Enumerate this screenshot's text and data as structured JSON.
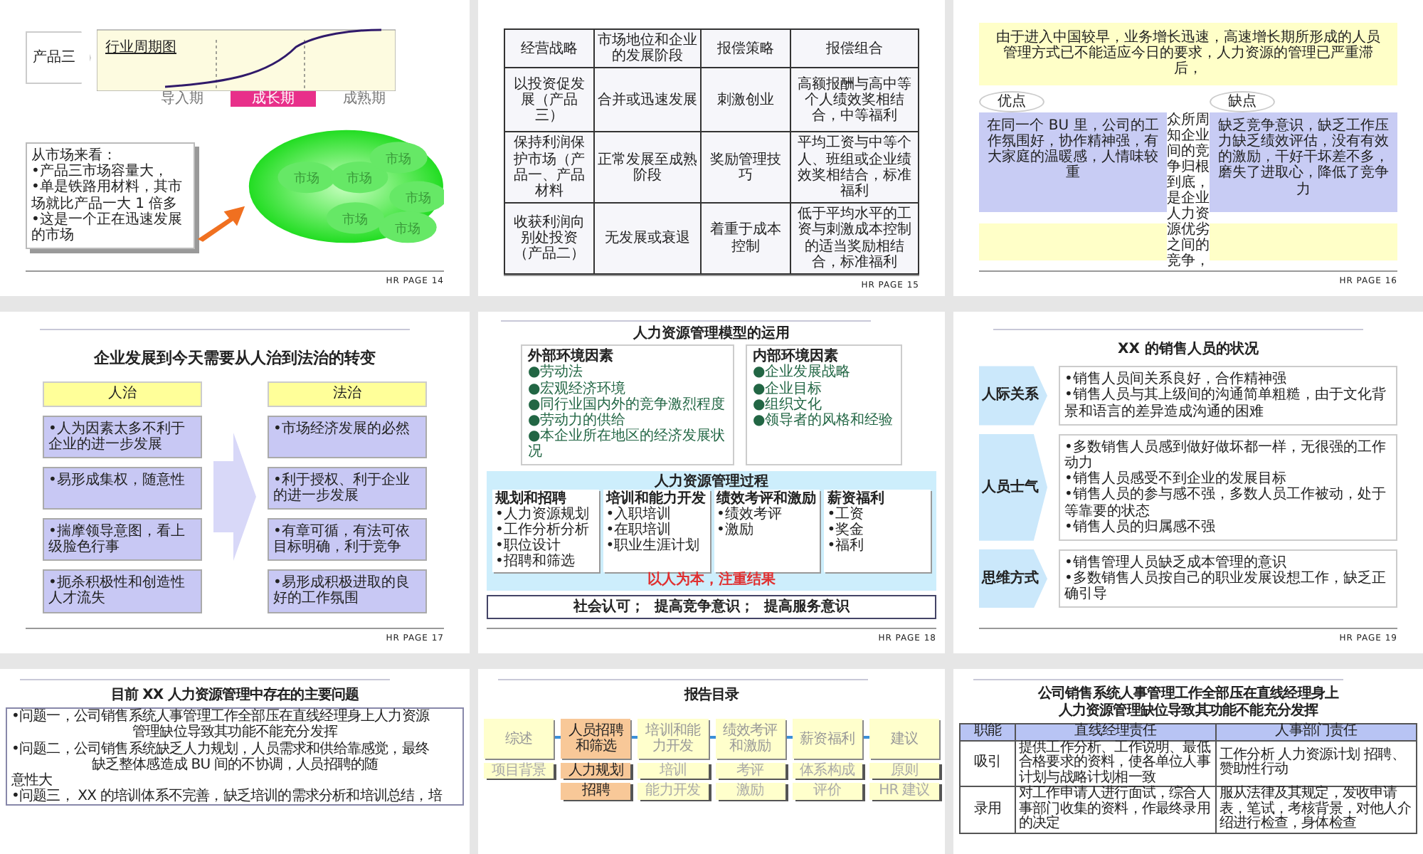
{
  "slides": [
    {
      "kind": "lifecycle",
      "page": "HR PAGE 14",
      "product": "产品三",
      "chart_label": "行业周期图",
      "phases": [
        {
          "label": "导入期",
          "selected": false
        },
        {
          "label": "成长期",
          "selected": true
        },
        {
          "label": "成熟期",
          "selected": false
        }
      ],
      "note": [
        "从市场来看：",
        "•产品三市场容量大，",
        "•单是铁路用材料，其市场就比产品一大 1 倍多",
        "•这是一个正在迅速发展的市场"
      ],
      "markets": [
        "市场",
        "市场",
        "市场",
        "市场",
        "市场",
        "市场"
      ]
    },
    {
      "kind": "table",
      "page": "HR PAGE 15",
      "columns": [
        "经营战略",
        "市场地位和企业的发展阶段",
        "报偿策略",
        "报偿组合"
      ],
      "rows": [
        [
          "以投资促发展（产品三）",
          "合并或迅速发展",
          "刺激创业",
          "高额报酬与高中等个人绩效奖相结合，中等福利"
        ],
        [
          "保持利润保护市场（产品一、产品材料",
          "正常发展至成熟阶段",
          "奖励管理技巧",
          "平均工资与中等个人、班组或企业绩效奖相结合，标准福利"
        ],
        [
          "收获利润向别处投资（产品二）",
          "无发展或衰退",
          "着重于成本控制",
          "低于平均水平的工资与刺激成本控制的适当奖励相结合，标准福利"
        ]
      ]
    },
    {
      "kind": "pros_cons",
      "page": "HR PAGE 16",
      "intro": "由于进入中国较早，业务增长迅速，高速增长期所形成的人员管理方式已不能适应今日的要求，人力资源的管理已严重滞后，",
      "pros_label": "优点",
      "pros": "在同一个 BU 里，公司的工作氛围好，协作精神强，有大家庭的温暖感，人情味较重",
      "cons_label": "缺点",
      "cons": "缺乏竞争意识，缺乏工作压力缺乏绩效评估，没有有效的激励，干好干坏差不多，磨失了进取心，降低了竞争力",
      "column_text": "众所周知企业间的竞争归根到底，是企业人力资源优劣之间的竞争，"
    },
    {
      "kind": "compare",
      "page": "HR PAGE 17",
      "title": "企业发展到今天需要从人治到法治的转变",
      "left": {
        "heading": "人治",
        "items": [
          "•人为因素太多不利于企业的进一步发展",
          "•易形成集权，随意性",
          "•揣摩领导意图，看上级脸色行事",
          "•扼杀积极性和创造性人才流失"
        ]
      },
      "right": {
        "heading": "法治",
        "items": [
          "•市场经济发展的必然",
          "•利于授权、利于企业的进一步发展",
          "•有章可循，有法可依目标明确，利于竞争",
          "•易形成积极进取的良好的工作氛围"
        ]
      }
    },
    {
      "kind": "model",
      "page": "HR PAGE 18",
      "title": "人力资源管理模型的运用",
      "factors": [
        {
          "heading": "外部环境因素",
          "items": [
            "●劳动法",
            "●宏观经济环境",
            "●同行业国内外的竞争激烈程度",
            "●劳动力的供给",
            "●本企业所在地区的经济发展状况"
          ]
        },
        {
          "heading": "内部环境因素",
          "items": [
            "●企业发展战略",
            "●企业目标",
            "●组织文化",
            "●领导者的风格和经验"
          ]
        }
      ],
      "process_title": "人力资源管理过程",
      "groups": [
        {
          "heading": "规划和招聘",
          "items": [
            "•人力资源规划",
            "•工作分析分析",
            "•职位设计",
            "•招聘和筛选"
          ]
        },
        {
          "heading": "培训和能力开发",
          "items": [
            "•入职培训",
            "•在职培训",
            "•职业生涯计划"
          ]
        },
        {
          "heading": "绩效考评和激励",
          "items": [
            "•绩效考评",
            "•激励"
          ]
        },
        {
          "heading": "薪资福利",
          "items": [
            "•工资",
            "•奖金",
            "•福利"
          ]
        }
      ],
      "motto": "以人为本，注重结果",
      "outcome": "社会认可；  提高竞争意识；  提高服务意识"
    },
    {
      "kind": "status",
      "page": "HR PAGE 19",
      "title": "XX 的销售人员的状况",
      "rows": [
        {
          "label": "人际关系",
          "items": [
            "•销售人员间关系良好，合作精神强",
            "•销售人员与其上级间的沟通简单粗糙，由于文化背景和语言的差异造成沟通的困难"
          ]
        },
        {
          "label": "人员士气",
          "items": [
            "•多数销售人员感到做好做坏都一样，无很强的工作动力",
            "•销售人员感受不到企业的发展目标",
            "•销售人员的参与感不强，多数人员工作被动，处于等靠要的状态",
            "•销售人员的归属感不强"
          ]
        },
        {
          "label": "思维方式",
          "items": [
            "•销售管理人员缺乏成本管理的意识",
            "•多数销售人员按自己的职业发展设想工作，缺乏正确引导"
          ]
        }
      ]
    },
    {
      "kind": "problems",
      "title": "目前 XX 人力资源管理中存在的主要问题",
      "lines": [
        {
          "text": "•问题一，公司销售系统人事管理工作全部压在直线经理身上人力资源",
          "kind": "plain"
        },
        {
          "text": "管理缺位导致其功能不能充分发挥",
          "kind": "indent"
        },
        {
          "text": "•问题二，公司销售系统缺乏人力规划，人员需求和供给靠感觉，最终",
          "kind": "plain"
        },
        {
          "text": "缺乏整体感造成 BU 间的不协调，人员招聘的随",
          "kind": "indent"
        },
        {
          "text": "意性大",
          "kind": "plain"
        },
        {
          "text": "•问题三， XX 的培训体系不完善，缺乏培训的需求分析和培训总结，培",
          "kind": "plain"
        }
      ]
    },
    {
      "kind": "agenda",
      "title": "报告目录",
      "sections": [
        {
          "heading": "综述",
          "selected": false,
          "items": [
            "项目背景"
          ]
        },
        {
          "heading": "人员招聘和筛选",
          "selected": true,
          "items": [
            "人力规划",
            "招聘"
          ]
        },
        {
          "heading": "培训和能力开发",
          "selected": false,
          "items": [
            "培训",
            "能力开发"
          ]
        },
        {
          "heading": "绩效考评和激励",
          "selected": false,
          "items": [
            "考评",
            "激励"
          ]
        },
        {
          "heading": "薪资福利",
          "selected": false,
          "items": [
            "体系构成",
            "评价"
          ]
        },
        {
          "heading": "建议",
          "selected": false,
          "items": [
            "原则",
            "HR 建议"
          ]
        }
      ]
    },
    {
      "kind": "duties",
      "title_lines": [
        "公司销售系统人事管理工作全部压在直线经理身上",
        "人力资源管理缺位导致其功能不能充分发挥"
      ],
      "columns": [
        "职能",
        "直线经理责任",
        "人事部门责任"
      ],
      "rows": [
        [
          "吸引",
          "提供工作分析、工作说明、最低合格要求的资料，使各单位人事计划与战略计划相一致",
          "工作分析 人力资源计划 招聘、赞助性行动"
        ],
        [
          "录用",
          "对工作申请人进行面试，综合人事部门收集的资料，作最终录用的决定",
          "服从法律及其规定，发收申请表，笔试，考核背景，对他人介绍进行检查，身体检查"
        ]
      ]
    }
  ]
}
